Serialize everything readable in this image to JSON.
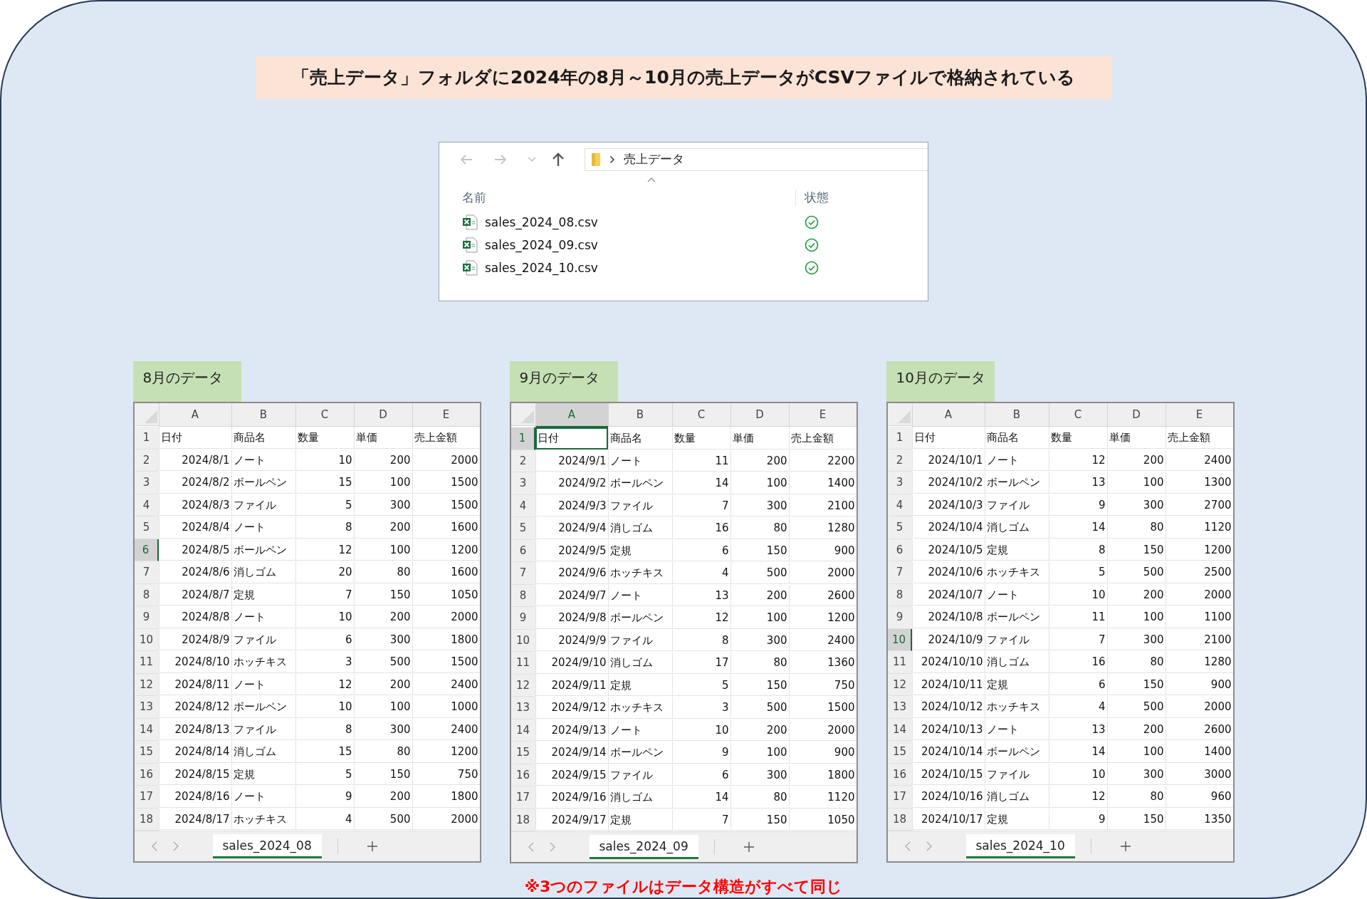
{
  "title": "「売上データ」フォルダに2024年の8月～10月の売上データがCSVファイルで格納されている",
  "explorer": {
    "breadcrumb": "売上データ",
    "columns": [
      "名前",
      "状態"
    ],
    "files": [
      {
        "name": "sales_2024_08.csv",
        "synced": true
      },
      {
        "name": "sales_2024_09.csv",
        "synced": true
      },
      {
        "name": "sales_2024_10.csv",
        "synced": true
      }
    ]
  },
  "sheets": [
    {
      "label": "8月のデータ",
      "tab": "sales_2024_08",
      "columns": [
        {
          "label": "A",
          "selected": false
        },
        {
          "label": "B",
          "selected": false
        },
        {
          "label": "C",
          "selected": false
        },
        {
          "label": "D",
          "selected": false
        },
        {
          "label": "E",
          "selected": false
        }
      ],
      "rows": [
        {
          "number": "1",
          "kind": "header",
          "selected": false,
          "cells": [
            "日付",
            "商品名",
            "数量",
            "単価",
            "売上金額"
          ]
        },
        {
          "number": "2",
          "kind": "data",
          "selected": false,
          "cells": [
            "2024/8/1",
            "ノート",
            "10",
            "200",
            "2000"
          ]
        },
        {
          "number": "3",
          "kind": "data",
          "selected": false,
          "cells": [
            "2024/8/2",
            "ボールペン",
            "15",
            "100",
            "1500"
          ]
        },
        {
          "number": "4",
          "kind": "data",
          "selected": false,
          "cells": [
            "2024/8/3",
            "ファイル",
            "5",
            "300",
            "1500"
          ]
        },
        {
          "number": "5",
          "kind": "data",
          "selected": false,
          "cells": [
            "2024/8/4",
            "ノート",
            "8",
            "200",
            "1600"
          ]
        },
        {
          "number": "6",
          "kind": "data",
          "selected": true,
          "cells": [
            "2024/8/5",
            "ボールペン",
            "12",
            "100",
            "1200"
          ]
        },
        {
          "number": "7",
          "kind": "data",
          "selected": false,
          "cells": [
            "2024/8/6",
            "消しゴム",
            "20",
            "80",
            "1600"
          ]
        },
        {
          "number": "8",
          "kind": "data",
          "selected": false,
          "cells": [
            "2024/8/7",
            "定規",
            "7",
            "150",
            "1050"
          ]
        },
        {
          "number": "9",
          "kind": "data",
          "selected": false,
          "cells": [
            "2024/8/8",
            "ノート",
            "10",
            "200",
            "2000"
          ]
        },
        {
          "number": "10",
          "kind": "data",
          "selected": false,
          "cells": [
            "2024/8/9",
            "ファイル",
            "6",
            "300",
            "1800"
          ]
        },
        {
          "number": "11",
          "kind": "data",
          "selected": false,
          "cells": [
            "2024/8/10",
            "ホッチキス",
            "3",
            "500",
            "1500"
          ]
        },
        {
          "number": "12",
          "kind": "data",
          "selected": false,
          "cells": [
            "2024/8/11",
            "ノート",
            "12",
            "200",
            "2400"
          ]
        },
        {
          "number": "13",
          "kind": "data",
          "selected": false,
          "cells": [
            "2024/8/12",
            "ボールペン",
            "10",
            "100",
            "1000"
          ]
        },
        {
          "number": "14",
          "kind": "data",
          "selected": false,
          "cells": [
            "2024/8/13",
            "ファイル",
            "8",
            "300",
            "2400"
          ]
        },
        {
          "number": "15",
          "kind": "data",
          "selected": false,
          "cells": [
            "2024/8/14",
            "消しゴム",
            "15",
            "80",
            "1200"
          ]
        },
        {
          "number": "16",
          "kind": "data",
          "selected": false,
          "cells": [
            "2024/8/15",
            "定規",
            "5",
            "150",
            "750"
          ]
        },
        {
          "number": "17",
          "kind": "data",
          "selected": false,
          "cells": [
            "2024/8/16",
            "ノート",
            "9",
            "200",
            "1800"
          ]
        },
        {
          "number": "18",
          "kind": "data",
          "selected": false,
          "cells": [
            "2024/8/17",
            "ホッチキス",
            "4",
            "500",
            "2000"
          ]
        }
      ]
    },
    {
      "label": "9月のデータ",
      "tab": "sales_2024_09",
      "columns": [
        {
          "label": "A",
          "selected": true
        },
        {
          "label": "B",
          "selected": false
        },
        {
          "label": "C",
          "selected": false
        },
        {
          "label": "D",
          "selected": false
        },
        {
          "label": "E",
          "selected": false
        }
      ],
      "rows": [
        {
          "number": "1",
          "kind": "header",
          "selected": true,
          "cells": [
            "日付",
            "商品名",
            "数量",
            "単価",
            "売上金額"
          ]
        },
        {
          "number": "2",
          "kind": "data",
          "selected": false,
          "cells": [
            "2024/9/1",
            "ノート",
            "11",
            "200",
            "2200"
          ]
        },
        {
          "number": "3",
          "kind": "data",
          "selected": false,
          "cells": [
            "2024/9/2",
            "ボールペン",
            "14",
            "100",
            "1400"
          ]
        },
        {
          "number": "4",
          "kind": "data",
          "selected": false,
          "cells": [
            "2024/9/3",
            "ファイル",
            "7",
            "300",
            "2100"
          ]
        },
        {
          "number": "5",
          "kind": "data",
          "selected": false,
          "cells": [
            "2024/9/4",
            "消しゴム",
            "16",
            "80",
            "1280"
          ]
        },
        {
          "number": "6",
          "kind": "data",
          "selected": false,
          "cells": [
            "2024/9/5",
            "定規",
            "6",
            "150",
            "900"
          ]
        },
        {
          "number": "7",
          "kind": "data",
          "selected": false,
          "cells": [
            "2024/9/6",
            "ホッチキス",
            "4",
            "500",
            "2000"
          ]
        },
        {
          "number": "8",
          "kind": "data",
          "selected": false,
          "cells": [
            "2024/9/7",
            "ノート",
            "13",
            "200",
            "2600"
          ]
        },
        {
          "number": "9",
          "kind": "data",
          "selected": false,
          "cells": [
            "2024/9/8",
            "ボールペン",
            "12",
            "100",
            "1200"
          ]
        },
        {
          "number": "10",
          "kind": "data",
          "selected": false,
          "cells": [
            "2024/9/9",
            "ファイル",
            "8",
            "300",
            "2400"
          ]
        },
        {
          "number": "11",
          "kind": "data",
          "selected": false,
          "cells": [
            "2024/9/10",
            "消しゴム",
            "17",
            "80",
            "1360"
          ]
        },
        {
          "number": "12",
          "kind": "data",
          "selected": false,
          "cells": [
            "2024/9/11",
            "定規",
            "5",
            "150",
            "750"
          ]
        },
        {
          "number": "13",
          "kind": "data",
          "selected": false,
          "cells": [
            "2024/9/12",
            "ホッチキス",
            "3",
            "500",
            "1500"
          ]
        },
        {
          "number": "14",
          "kind": "data",
          "selected": false,
          "cells": [
            "2024/9/13",
            "ノート",
            "10",
            "200",
            "2000"
          ]
        },
        {
          "number": "15",
          "kind": "data",
          "selected": false,
          "cells": [
            "2024/9/14",
            "ボールペン",
            "9",
            "100",
            "900"
          ]
        },
        {
          "number": "16",
          "kind": "data",
          "selected": false,
          "cells": [
            "2024/9/15",
            "ファイル",
            "6",
            "300",
            "1800"
          ]
        },
        {
          "number": "17",
          "kind": "data",
          "selected": false,
          "cells": [
            "2024/9/16",
            "消しゴム",
            "14",
            "80",
            "1120"
          ]
        },
        {
          "number": "18",
          "kind": "data",
          "selected": false,
          "cells": [
            "2024/9/17",
            "定規",
            "7",
            "150",
            "1050"
          ]
        }
      ]
    },
    {
      "label": "10月のデータ",
      "tab": "sales_2024_10",
      "columns": [
        {
          "label": "A",
          "selected": false
        },
        {
          "label": "B",
          "selected": false
        },
        {
          "label": "C",
          "selected": false
        },
        {
          "label": "D",
          "selected": false
        },
        {
          "label": "E",
          "selected": false
        }
      ],
      "rows": [
        {
          "number": "1",
          "kind": "header",
          "selected": false,
          "cells": [
            "日付",
            "商品名",
            "数量",
            "単価",
            "売上金額"
          ]
        },
        {
          "number": "2",
          "kind": "data",
          "selected": false,
          "cells": [
            "2024/10/1",
            "ノート",
            "12",
            "200",
            "2400"
          ]
        },
        {
          "number": "3",
          "kind": "data",
          "selected": false,
          "cells": [
            "2024/10/2",
            "ボールペン",
            "13",
            "100",
            "1300"
          ]
        },
        {
          "number": "4",
          "kind": "data",
          "selected": false,
          "cells": [
            "2024/10/3",
            "ファイル",
            "9",
            "300",
            "2700"
          ]
        },
        {
          "number": "5",
          "kind": "data",
          "selected": false,
          "cells": [
            "2024/10/4",
            "消しゴム",
            "14",
            "80",
            "1120"
          ]
        },
        {
          "number": "6",
          "kind": "data",
          "selected": false,
          "cells": [
            "2024/10/5",
            "定規",
            "8",
            "150",
            "1200"
          ]
        },
        {
          "number": "7",
          "kind": "data",
          "selected": false,
          "cells": [
            "2024/10/6",
            "ホッチキス",
            "5",
            "500",
            "2500"
          ]
        },
        {
          "number": "8",
          "kind": "data",
          "selected": false,
          "cells": [
            "2024/10/7",
            "ノート",
            "10",
            "200",
            "2000"
          ]
        },
        {
          "number": "9",
          "kind": "data",
          "selected": false,
          "cells": [
            "2024/10/8",
            "ボールペン",
            "11",
            "100",
            "1100"
          ]
        },
        {
          "number": "10",
          "kind": "data",
          "selected": true,
          "cells": [
            "2024/10/9",
            "ファイル",
            "7",
            "300",
            "2100"
          ]
        },
        {
          "number": "11",
          "kind": "data",
          "selected": false,
          "cells": [
            "2024/10/10",
            "消しゴム",
            "16",
            "80",
            "1280"
          ]
        },
        {
          "number": "12",
          "kind": "data",
          "selected": false,
          "cells": [
            "2024/10/11",
            "定規",
            "6",
            "150",
            "900"
          ]
        },
        {
          "number": "13",
          "kind": "data",
          "selected": false,
          "cells": [
            "2024/10/12",
            "ホッチキス",
            "4",
            "500",
            "2000"
          ]
        },
        {
          "number": "14",
          "kind": "data",
          "selected": false,
          "cells": [
            "2024/10/13",
            "ノート",
            "13",
            "200",
            "2600"
          ]
        },
        {
          "number": "15",
          "kind": "data",
          "selected": false,
          "cells": [
            "2024/10/14",
            "ボールペン",
            "14",
            "100",
            "1400"
          ]
        },
        {
          "number": "16",
          "kind": "data",
          "selected": false,
          "cells": [
            "2024/10/15",
            "ファイル",
            "10",
            "300",
            "3000"
          ]
        },
        {
          "number": "17",
          "kind": "data",
          "selected": false,
          "cells": [
            "2024/10/16",
            "消しゴム",
            "12",
            "80",
            "960"
          ]
        },
        {
          "number": "18",
          "kind": "data",
          "selected": false,
          "cells": [
            "2024/10/17",
            "定規",
            "9",
            "150",
            "1350"
          ]
        }
      ]
    }
  ],
  "note": "※3つのファイルはデータ構造がすべて同じ"
}
